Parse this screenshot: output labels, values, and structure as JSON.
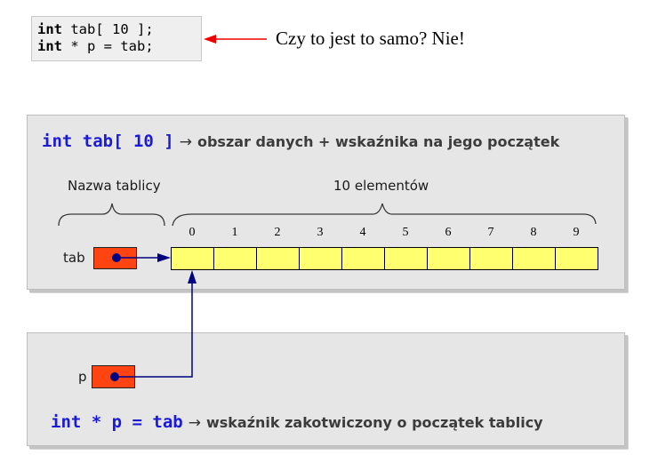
{
  "code_snippet": {
    "lines": [
      {
        "keyword": "int",
        "rest": " tab[ 10 ];"
      },
      {
        "keyword": "int",
        "rest": " * p = tab;"
      }
    ]
  },
  "question": {
    "text": "Czy to jest to samo? Nie!",
    "arrow_color": "#ee0000"
  },
  "panel_array": {
    "code": "int tab[ 10 ]",
    "arrow": "→",
    "description": "obszar danych + wskaźnika na jego początek",
    "name_label": "Nazwa tablicy",
    "elements_label": "10 elementów",
    "pointer_label": "tab",
    "indices": [
      "0",
      "1",
      "2",
      "3",
      "4",
      "5",
      "6",
      "7",
      "8",
      "9"
    ]
  },
  "panel_pointer": {
    "code": "int * p = tab",
    "arrow": "→",
    "description": "wskaźnik zakotwiczony o początek tablicy",
    "pointer_label": "p"
  },
  "colors": {
    "code_blue": "#1a1ad8",
    "pointer_box": "#ff4412",
    "array_cell": "#ffff70",
    "pointer_line": "#000080",
    "panel_bg": "#e6e6e6"
  }
}
